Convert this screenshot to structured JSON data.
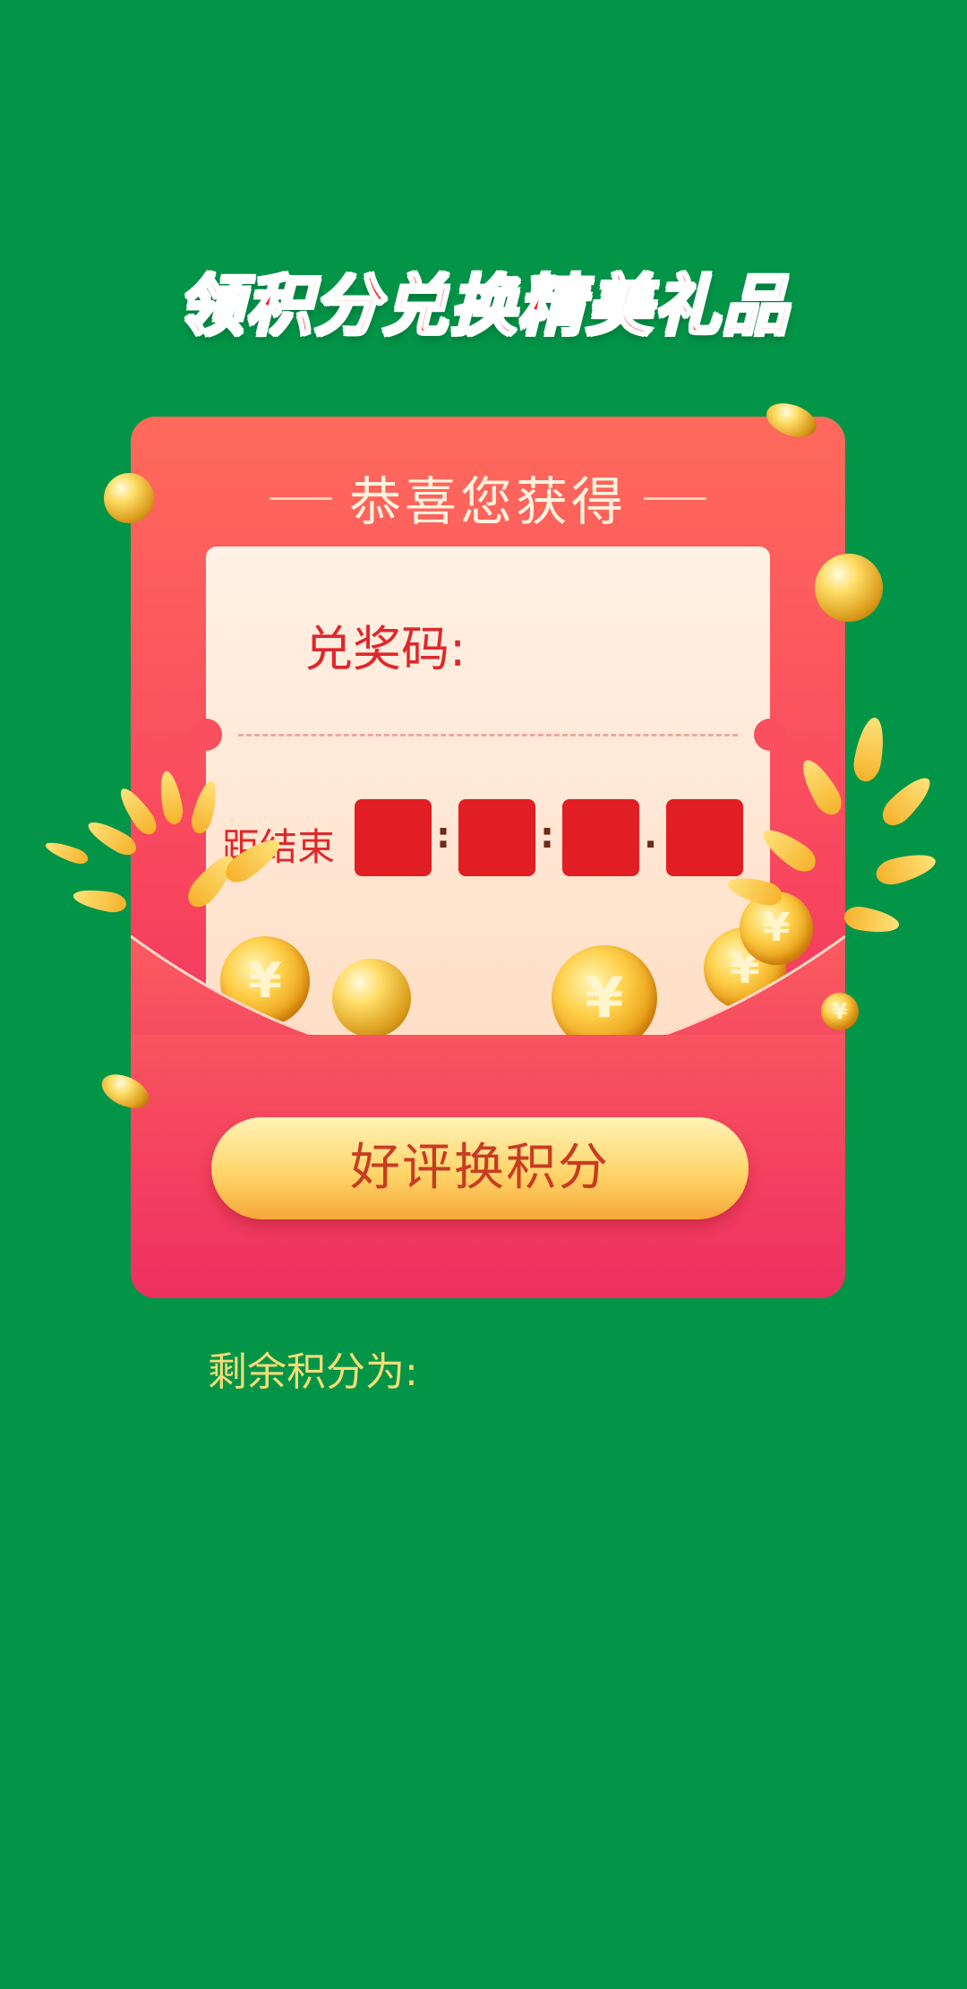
{
  "banner": {
    "title": "领积分兑换精美礼品"
  },
  "card": {
    "header": "恭喜您获得",
    "code_label": "兑奖码:",
    "countdown_label": "距结束",
    "separators": [
      ":",
      ":",
      "."
    ],
    "action_button": "好评换积分"
  },
  "footer": {
    "remaining_label": "剩余积分为:"
  },
  "decor": {
    "coin_glyph": "¥"
  },
  "colors": {
    "background": "#029548",
    "card_top": "#ff6a5c",
    "card_bottom": "#ea2560",
    "title_red": "#ff1414",
    "countdown_box": "#e11e23",
    "button_gold": "#ffd56a",
    "remaining_text": "#f6dc76"
  },
  "icons": [
    "gold-coin-icon",
    "gold-ball-icon",
    "golden-leaf-icon"
  ]
}
